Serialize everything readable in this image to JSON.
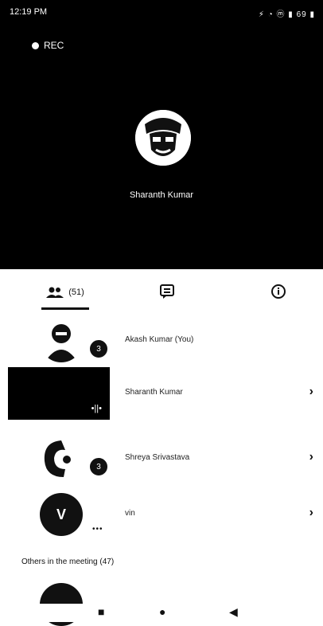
{
  "status_bar": {
    "time": "12:19 PM",
    "right": "⚡ ◔ ⓜ ▮ 69 ▮"
  },
  "video": {
    "rec_label": "REC",
    "speaker_name": "Sharanth Kumar"
  },
  "tabs": {
    "people_count": "(51)"
  },
  "participants": [
    {
      "name": "Akash Kumar (You)",
      "badge": "3"
    },
    {
      "name": "Sharanth Kumar",
      "volume": "•||•"
    },
    {
      "name": "Shreya Srivastava",
      "badge": "3"
    },
    {
      "name": "vin",
      "initial": "V",
      "more": "•••"
    }
  ],
  "others_label": "Others in the meeting (47)"
}
